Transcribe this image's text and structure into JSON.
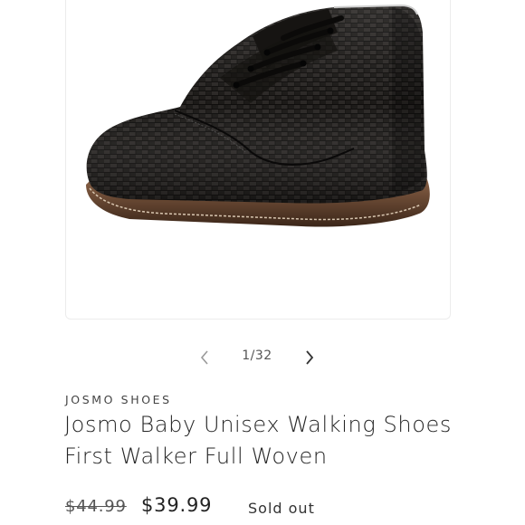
{
  "gallery": {
    "image_alt": "Black woven leather baby walking shoe",
    "current": "1",
    "total": "32",
    "counter_text": "1/32",
    "prev_icon": "chevron-left-icon",
    "next_icon": "chevron-right-icon"
  },
  "product": {
    "vendor": "JOSMO SHOES",
    "title_line1": "Josmo Baby Unisex Walking Shoes",
    "title_line2": "First Walker Full Woven",
    "compare_price": "$44.99",
    "sale_price": "$39.99",
    "availability": "Sold out"
  },
  "colors": {
    "background": "#ffffff",
    "text": "#222222",
    "shoe": "#1a1816",
    "sole": "#6b4a35"
  }
}
